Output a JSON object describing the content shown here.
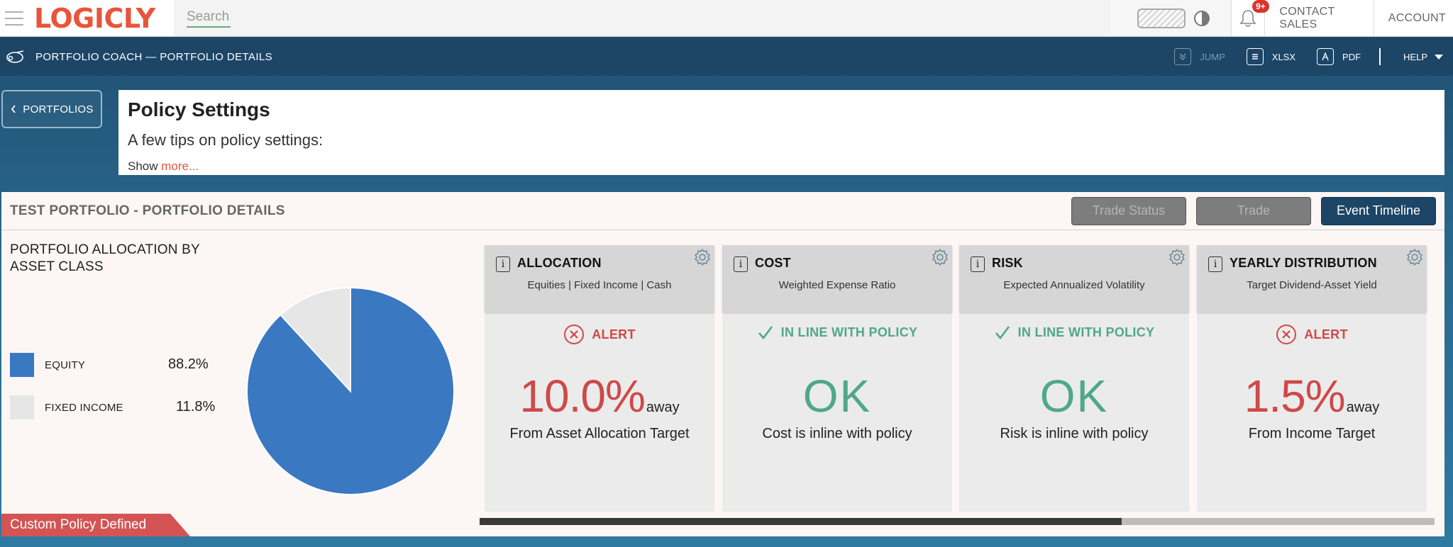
{
  "topbar": {
    "logo": "LOGICLY",
    "search_placeholder": "Search",
    "notification_badge": "9+",
    "contact_sales": "CONTACT SALES",
    "account": "ACCOUNT"
  },
  "subbar": {
    "title": "PORTFOLIO COACH — PORTFOLIO DETAILS",
    "jump": "JUMP",
    "xlsx": "XLSX",
    "pdf": "PDF",
    "help": "HELP"
  },
  "back_button": "PORTFOLIOS",
  "policy": {
    "title": "Policy Settings",
    "subtitle": "A few tips on policy settings:",
    "show": "Show",
    "more": "more..."
  },
  "details": {
    "title": "TEST PORTFOLIO - PORTFOLIO DETAILS",
    "buttons": {
      "trade_status": "Trade Status",
      "trade": "Trade",
      "event_timeline": "Event Timeline"
    },
    "allocation_title_line1": "PORTFOLIO ALLOCATION BY",
    "allocation_title_line2": "ASSET CLASS",
    "legend": [
      {
        "label": "EQUITY",
        "value": "88.2%",
        "color": "#3a78c2"
      },
      {
        "label": "FIXED INCOME",
        "value": "11.8%",
        "color": "#e6e6e6"
      }
    ],
    "custom_tag": "Custom Policy Defined",
    "scroll_progress": 0.672
  },
  "chart_data": {
    "type": "pie",
    "categories": [
      "EQUITY",
      "FIXED INCOME"
    ],
    "values": [
      88.2,
      11.8
    ],
    "colors": [
      "#3a78c2",
      "#e6e6e6"
    ],
    "title": "PORTFOLIO ALLOCATION BY ASSET CLASS"
  },
  "cards": [
    {
      "title": "ALLOCATION",
      "subtitle": "Equities | Fixed Income | Cash",
      "status": "ALERT",
      "status_type": "alert",
      "value": "10.0%",
      "value_suffix": "away",
      "description": "From Asset Allocation Target"
    },
    {
      "title": "COST",
      "subtitle": "Weighted Expense Ratio",
      "status": "IN LINE WITH POLICY",
      "status_type": "ok",
      "value": "OK",
      "value_suffix": "",
      "description": "Cost is inline with policy"
    },
    {
      "title": "RISK",
      "subtitle": "Expected Annualized Volatility",
      "status": "IN LINE WITH POLICY",
      "status_type": "ok",
      "value": "OK",
      "value_suffix": "",
      "description": "Risk is inline with policy"
    },
    {
      "title": "YEARLY DISTRIBUTION",
      "subtitle": "Target Dividend-Asset Yield",
      "status": "ALERT",
      "status_type": "alert",
      "value": "1.5%",
      "value_suffix": "away",
      "description": "From Income Target"
    }
  ]
}
